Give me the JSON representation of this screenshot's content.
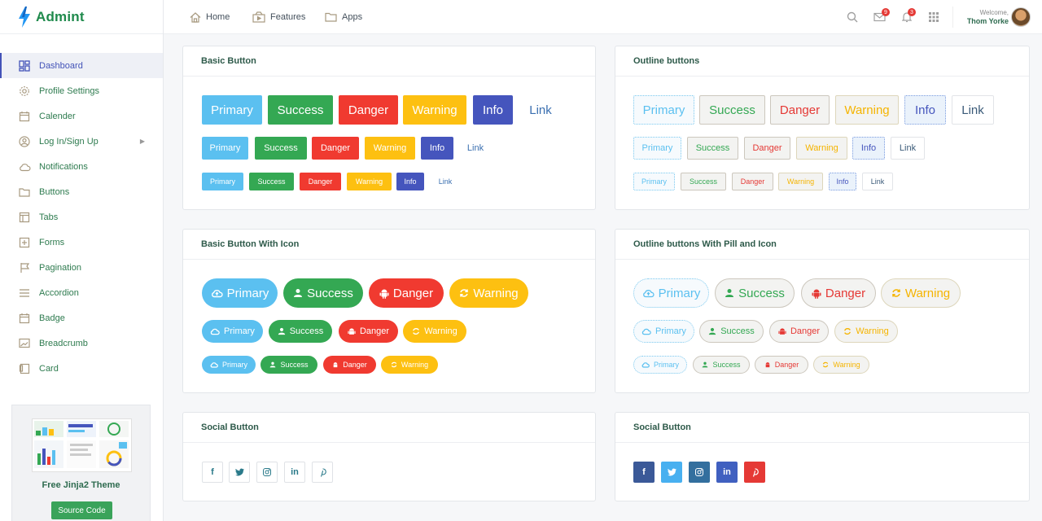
{
  "brand": "Admint",
  "topnav": {
    "home": "Home",
    "features": "Features",
    "apps": "Apps"
  },
  "topbar": {
    "mail_count": "9",
    "bell_count": "3",
    "welcome": "Welcome,",
    "user": "Thom Yorke"
  },
  "sidebar": {
    "items": [
      {
        "label": "Dashboard",
        "icon": "dashboard-icon"
      },
      {
        "label": "Profile Settings",
        "icon": "gear-icon"
      },
      {
        "label": "Calender",
        "icon": "calendar-icon"
      },
      {
        "label": "Log In/Sign Up",
        "icon": "user-icon"
      },
      {
        "label": "Notifications",
        "icon": "cloud-icon"
      },
      {
        "label": "Buttons",
        "icon": "folder-icon"
      },
      {
        "label": "Tabs",
        "icon": "tabs-icon"
      },
      {
        "label": "Forms",
        "icon": "forms-icon"
      },
      {
        "label": "Pagination",
        "icon": "flag-icon"
      },
      {
        "label": "Accordion",
        "icon": "menu-icon"
      },
      {
        "label": "Badge",
        "icon": "calendar-icon"
      },
      {
        "label": "Breadcrumb",
        "icon": "image-icon"
      },
      {
        "label": "Card",
        "icon": "card-icon"
      }
    ],
    "promo_title": "Free Jinja2 Theme",
    "promo_button": "Source Code"
  },
  "cards": {
    "basic": "Basic Button",
    "outline": "Outline buttons",
    "basic_icon": "Basic Button With Icon",
    "outline_pill": "Outline buttons With Pill and Icon",
    "social_left": "Social Button",
    "social_right": "Social Button"
  },
  "labels": {
    "primary": "Primary",
    "success": "Success",
    "danger": "Danger",
    "warning": "Warning",
    "info": "Info",
    "link": "Link"
  },
  "colors": {
    "primary": "#5bc0f0",
    "success": "#34a853",
    "danger": "#f03a30",
    "warning": "#fdc011",
    "info": "#4555bd"
  },
  "social": {
    "facebook": "f",
    "twitter": "twitter-icon",
    "instagram": "instagram-icon",
    "linkedin": "in",
    "pinterest": "pinterest-icon"
  }
}
